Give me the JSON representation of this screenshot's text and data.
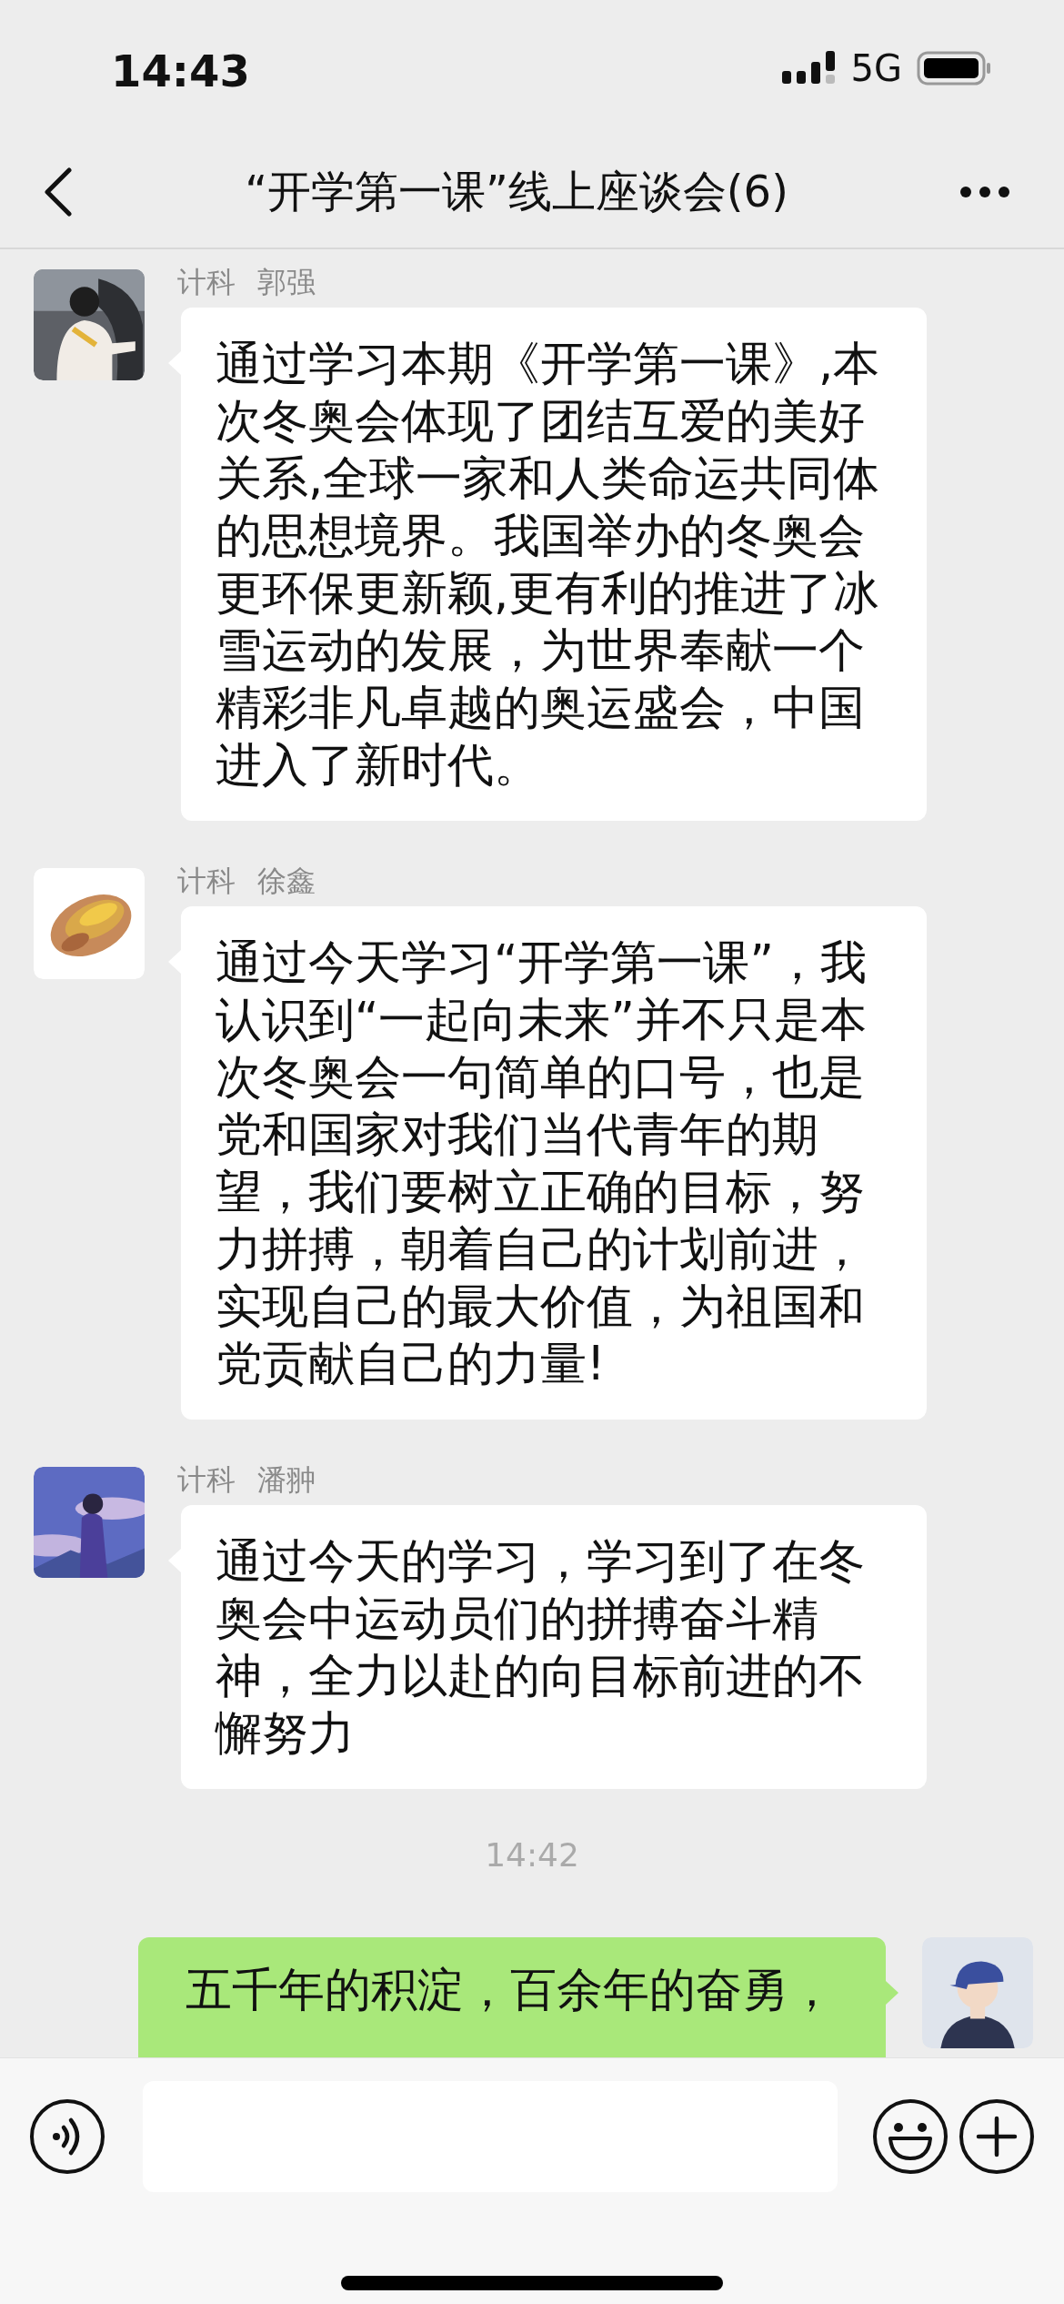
{
  "status_bar": {
    "time": "14:43",
    "network": "5G"
  },
  "header": {
    "title": "“开学第一课”线上座谈会(6)"
  },
  "messages": [
    {
      "kind": "incoming",
      "sender": "计科 郭强",
      "text": "通过学习本期《开学第一课》,本次冬奥会体现了团结互爱的美好关系,全球一家和人类命运共同体的思想境界。我国举办的冬奥会更环保更新颖,更有利的推进了冰雪运动的发展，为世界奉献一个精彩非凡卓越的奥运盛会，中国进入了新时代。"
    },
    {
      "kind": "incoming",
      "sender": "计科 徐鑫",
      "text": "通过今天学习“开学第一课”，我认识到“一起向未来”并不只是本次冬奥会一句简单的口号，也是党和国家对我们当代青年的期望，我们要树立正确的目标，努力拼搏，朝着自己的计划前进，实现自己的最大价值，为祖国和党贡献自己的力量!"
    },
    {
      "kind": "incoming",
      "sender": "计科 潘翀",
      "text": "通过今天的学习，学习到了在冬奥会中运动员们的拼搏奋斗精神，全力以赴的向目标前进的不懈努力"
    },
    {
      "kind": "time",
      "text": "14:42"
    },
    {
      "kind": "outgoing",
      "text": "五千年的积淀，百余年的奋勇，"
    }
  ]
}
